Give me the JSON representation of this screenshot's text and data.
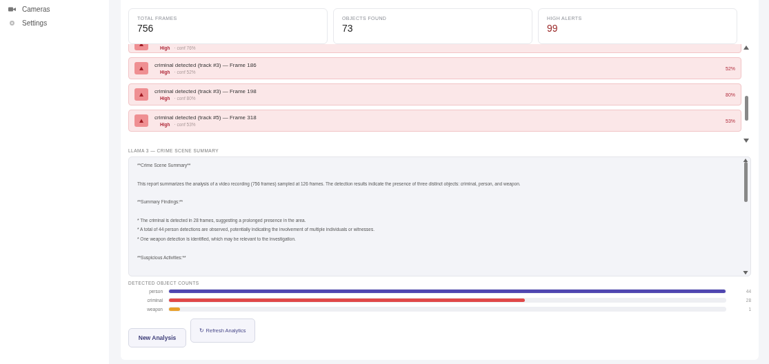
{
  "sidebar": {
    "items": [
      {
        "label": "Cameras"
      },
      {
        "label": "Settings"
      }
    ]
  },
  "stats": [
    {
      "label": "TOTAL FRAMES",
      "value": "756",
      "kind": "normal"
    },
    {
      "label": "OBJECTS FOUND",
      "value": "73",
      "kind": "normal"
    },
    {
      "label": "HIGH ALERTS",
      "value": "99",
      "kind": "alert"
    }
  ],
  "alerts": [
    {
      "severity": "High",
      "confidence": "· conf 76%",
      "kind": "partial"
    },
    {
      "title": "criminal detected (track #3) — Frame 186",
      "severity": "High",
      "confidence": "· conf 52%",
      "percent": "52%",
      "kind": "full"
    },
    {
      "title": "criminal detected (track #3) — Frame 198",
      "severity": "High",
      "confidence": "· conf 80%",
      "percent": "80%",
      "kind": "full"
    },
    {
      "title": "criminal detected (track #5) — Frame 318",
      "severity": "High",
      "confidence": "· conf 53%",
      "percent": "53%",
      "kind": "full"
    }
  ],
  "summary": {
    "heading": "LLAMA 3 — CRIME SCENE SUMMARY",
    "paragraphs": [
      [
        "**Crime Scene Summary**"
      ],
      [
        "This report summarizes the analysis of a video recording (756 frames) sampled at 126 frames. The detection results indicate the presence of three distinct objects: criminal, person, and weapon."
      ],
      [
        "**Summary Findings:**"
      ],
      [
        "* The criminal is detected in 28 frames, suggesting a prolonged presence in the area.",
        "* A total of 44 person detections are observed, potentially indicating the involvement of multiple individuals or witnesses.",
        "* One weapon detection is identified, which may be relevant to the investigation."
      ],
      [
        "**Suspicious Activities:**"
      ]
    ]
  },
  "counts": {
    "heading": "DETECTED OBJECT COUNTS",
    "items": [
      {
        "label": "person",
        "count": "44",
        "level": 1,
        "color": "#4f46b0"
      },
      {
        "label": "criminal",
        "count": "28",
        "level": 0.64,
        "color": "#e04848"
      },
      {
        "label": "weapon",
        "count": "1",
        "level": 0.02,
        "color": "#e8a02a"
      }
    ]
  },
  "buttons": [
    {
      "label": "New Analysis",
      "kind": "primary"
    },
    {
      "label": "↻ Refresh Analytics",
      "kind": "refresh"
    }
  ]
}
